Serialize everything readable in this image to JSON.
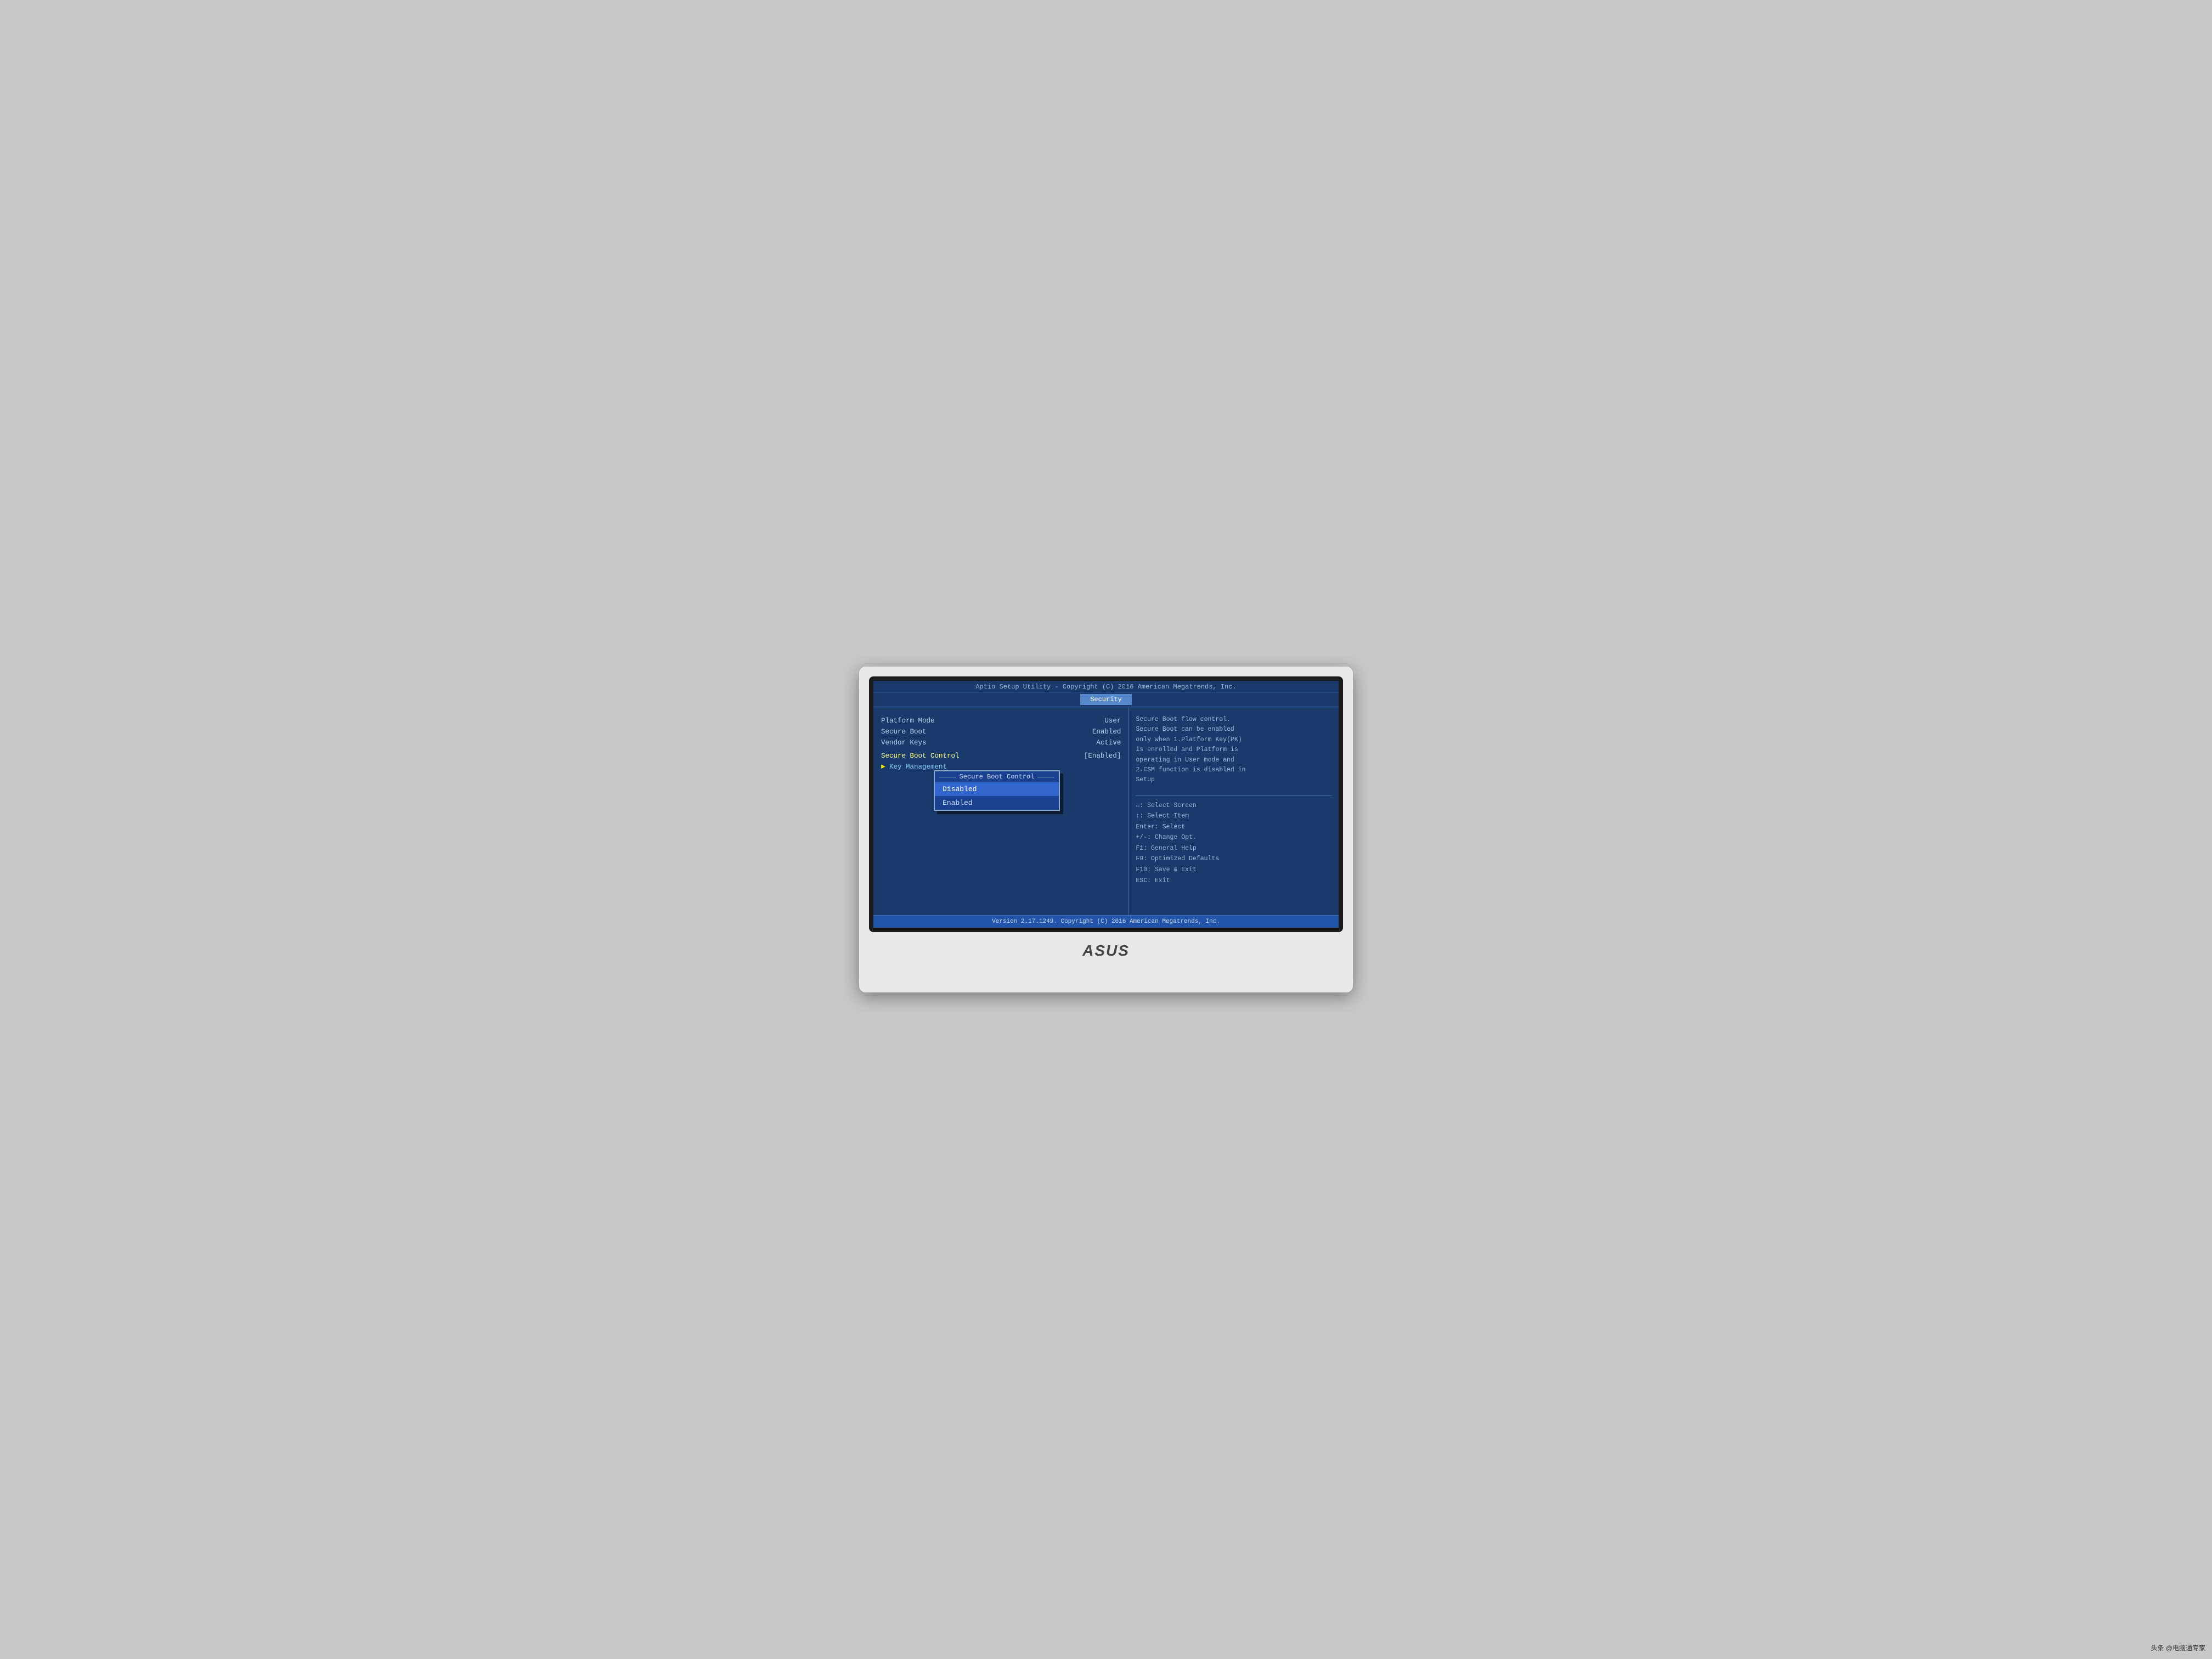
{
  "bios": {
    "title_bar": "Aptio Setup Utility - Copyright (C) 2016 American Megatrends, Inc.",
    "active_tab": "Security",
    "tabs": [
      "Security"
    ],
    "left_panel": {
      "rows": [
        {
          "label": "Platform Mode",
          "value": "User"
        },
        {
          "label": "Secure Boot",
          "value": "Enabled"
        },
        {
          "label": "Vendor Keys",
          "value": "Active"
        },
        {
          "label": "",
          "value": ""
        },
        {
          "label": "Secure Boot Control",
          "value": "[Enabled]"
        }
      ],
      "key_management_label": "Key Management"
    },
    "dropdown": {
      "title": "Secure Boot Control",
      "options": [
        {
          "label": "Disabled",
          "selected": false
        },
        {
          "label": "Enabled",
          "selected": false
        }
      ]
    },
    "right_panel": {
      "help_text": "Secure Boot flow control.\nSecure Boot can be enabled\nonly when 1.Platform Key(PK)\nis enrolled and Platform is\noperating in User mode and\n2.CSM function is disabled in\nSetup",
      "key_help": [
        "↔: Select Screen",
        "↕: Select Item",
        "Enter: Select",
        "+/-: Change Opt.",
        "F1: General Help",
        "F9: Optimized Defaults",
        "F10: Save & Exit",
        "ESC: Exit"
      ]
    },
    "bottom_bar": "Version 2.17.1249. Copyright (C) 2016 American Megatrends, Inc."
  },
  "laptop": {
    "brand": "ASUS"
  },
  "watermark": "头条 @电脑通专家"
}
